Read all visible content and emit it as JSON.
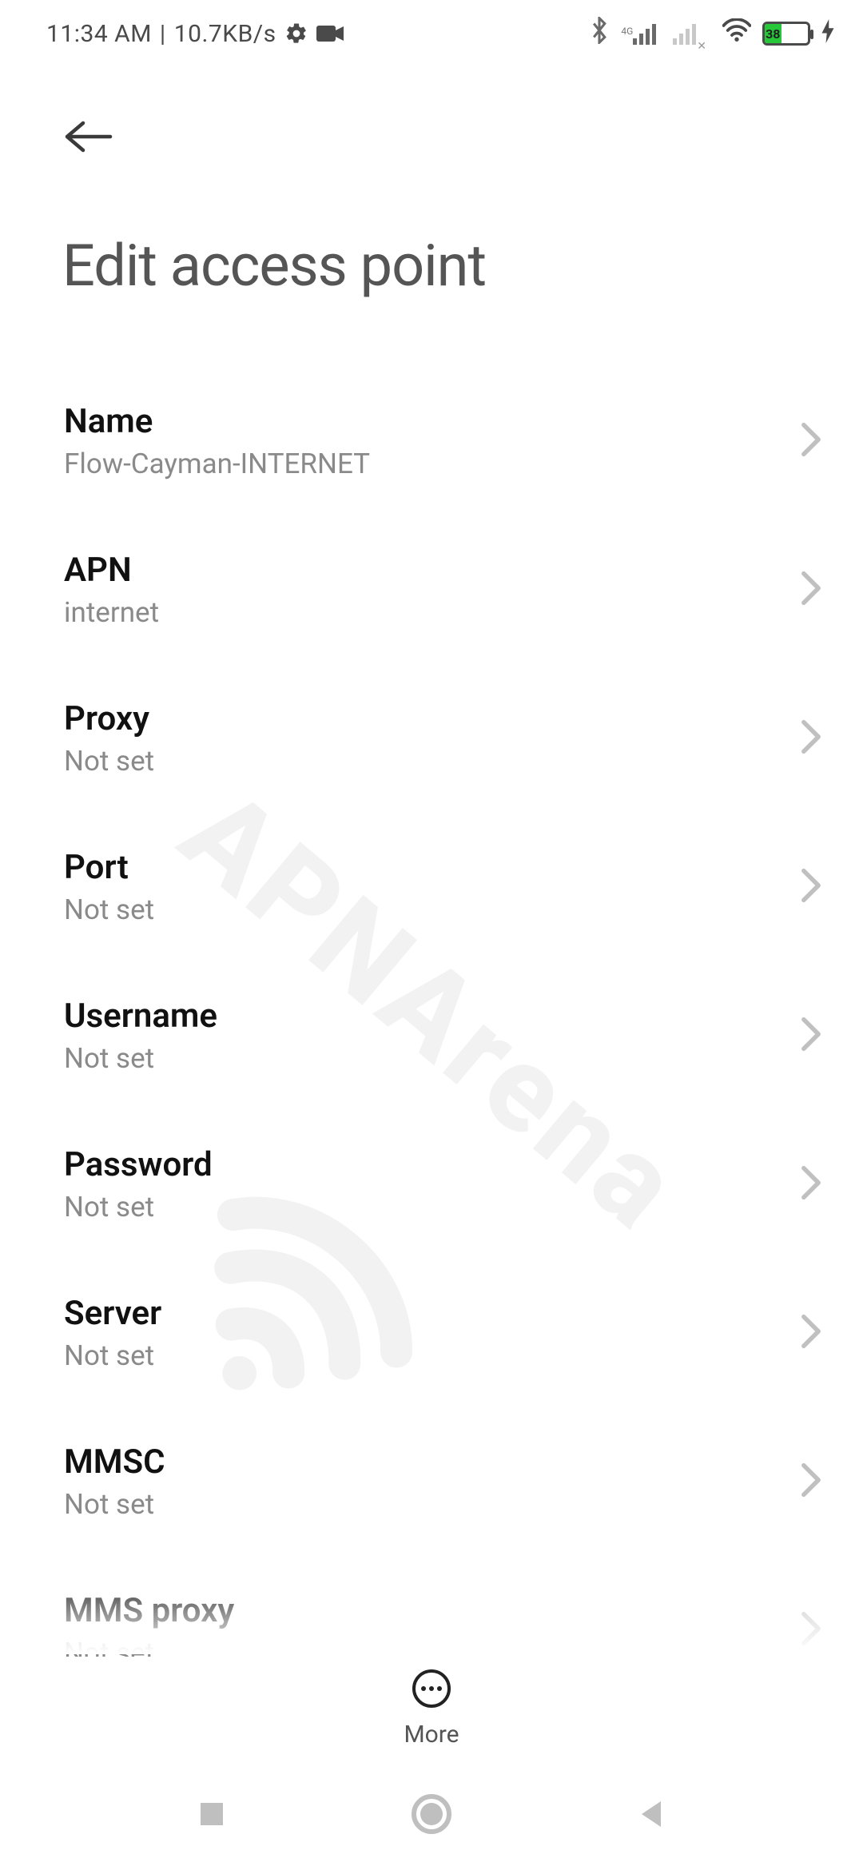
{
  "statusbar": {
    "time": "11:34 AM",
    "separator": "|",
    "netspeed": "10.7KB/s",
    "battery_pct": "38",
    "net_label": "4G"
  },
  "header": {
    "title": "Edit access point"
  },
  "items": [
    {
      "title": "Name",
      "value": "Flow-Cayman-INTERNET"
    },
    {
      "title": "APN",
      "value": "internet"
    },
    {
      "title": "Proxy",
      "value": "Not set"
    },
    {
      "title": "Port",
      "value": "Not set"
    },
    {
      "title": "Username",
      "value": "Not set"
    },
    {
      "title": "Password",
      "value": "Not set"
    },
    {
      "title": "Server",
      "value": "Not set"
    },
    {
      "title": "MMSC",
      "value": "Not set"
    },
    {
      "title": "MMS proxy",
      "value": "Not set"
    }
  ],
  "bottom": {
    "more_label": "More"
  },
  "watermark": {
    "text": "APNArena"
  }
}
